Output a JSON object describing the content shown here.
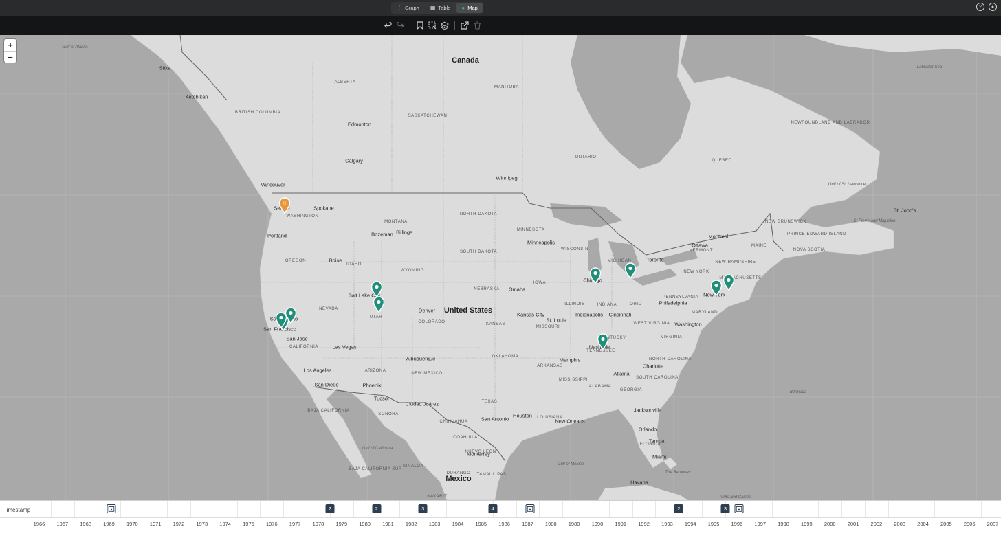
{
  "view_tabs": [
    {
      "label": "Graph",
      "icon": "graph-icon"
    },
    {
      "label": "Table",
      "icon": "table-icon"
    },
    {
      "label": "Map",
      "icon": "map-icon",
      "active": true
    }
  ],
  "map": {
    "labels": {
      "countries": [
        "Canada",
        "United States",
        "Mexico"
      ],
      "provinces": [
        "ALBERTA",
        "MANITOBA",
        "BRITISH COLUMBIA",
        "SASKATCHEWAN",
        "ONTARIO",
        "QUEBEC",
        "NEWFOUNDLAND AND LABRADOR",
        "NEW BRUNSWICK",
        "PRINCE EDWARD ISLAND",
        "NOVA SCOTIA"
      ],
      "states": [
        "WASHINGTON",
        "MONTANA",
        "NORTH DAKOTA",
        "MINNESOTA",
        "OREGON",
        "IDAHO",
        "WYOMING",
        "SOUTH DAKOTA",
        "WISCONSIN",
        "MICHIGAN",
        "NEVADA",
        "UTAH",
        "NEBRASKA",
        "IOWA",
        "ILLINOIS",
        "INDIANA",
        "OHIO",
        "PENNSYLVANIA",
        "CALIFORNIA",
        "COLORADO",
        "KANSAS",
        "MISSOURI",
        "KENTUCKY",
        "WEST VIRGINIA",
        "VIRGINIA",
        "ARIZONA",
        "NEW MEXICO",
        "OKLAHOMA",
        "ARKANSAS",
        "TENNESSEE",
        "NORTH CAROLINA",
        "SOUTH CAROLINA",
        "MISSISSIPPI",
        "ALABAMA",
        "GEORGIA",
        "TEXAS",
        "LOUISIANA",
        "FLORIDA",
        "NEW YORK",
        "VERMONT",
        "NEW HAMPSHIRE",
        "MAINE",
        "MASSACHUSETTS",
        "MARYLAND",
        "BAJA CALIFORNIA",
        "BAJA CALIFORNIA SUR",
        "SONORA",
        "CHIHUAHUA",
        "COAHUILA",
        "NUEVO LEON",
        "SINALOA",
        "DURANGO",
        "TAMAULIPAS",
        "NAYARIT"
      ],
      "cities": [
        "Edmonton",
        "Calgary",
        "Winnipeg",
        "Vancouver",
        "Seattle",
        "Spokane",
        "Portland",
        "Boise",
        "Bozeman",
        "Billings",
        "Minneapolis",
        "Toronto",
        "Montreal",
        "Ottawa",
        "Chicago",
        "Salt Lake City",
        "Denver",
        "Omaha",
        "Kansas City",
        "St. Louis",
        "Indianapolis",
        "Cincinnati",
        "Philadelphia",
        "New York",
        "Washington",
        "San Francisco",
        "Sacramento",
        "San Jose",
        "Las Vegas",
        "Los Angeles",
        "San Diego",
        "Phoenix",
        "Tucson",
        "Albuquerque",
        "Nashville",
        "Memphis",
        "Atlanta",
        "Charlotte",
        "Ciudad Juárez",
        "San Antonio",
        "Houston",
        "New Orleans",
        "Jacksonville",
        "Orlando",
        "Tampa",
        "Miami",
        "Havana",
        "Monterrey",
        "Ketchikan",
        "Sitka",
        "St. John's"
      ],
      "water_and_other": [
        "Gulf of Alaska",
        "Labrador Sea",
        "Gulf of St. Lawrence",
        "Gulf of California",
        "Gulf of Mexico",
        "Bermuda",
        "The Bahamas",
        "Turks and Caicos",
        "St Pierre and Miquelon"
      ]
    },
    "pins": [
      {
        "place": "Seattle",
        "color": "#e8963a",
        "glyph": "!!"
      },
      {
        "place": "Sacramento",
        "color": "#1f8f7a"
      },
      {
        "place": "San Francisco",
        "color": "#1f8f7a"
      },
      {
        "place": "San Francisco",
        "color": "#1f8f7a"
      },
      {
        "place": "Salt Lake City",
        "color": "#1f8f7a"
      },
      {
        "place": "Utah",
        "color": "#1f8f7a"
      },
      {
        "place": "Chicago",
        "color": "#1f8f7a"
      },
      {
        "place": "Michigan",
        "color": "#1f8f7a"
      },
      {
        "place": "Nashville",
        "color": "#1f8f7a"
      },
      {
        "place": "New York",
        "color": "#1f8f7a"
      },
      {
        "place": "Massachusetts",
        "color": "#1f8f7a"
      }
    ]
  },
  "timeline": {
    "row_label": "Timestamp",
    "years": [
      "1966",
      "1967",
      "1968",
      "1969",
      "1970",
      "1971",
      "1972",
      "1973",
      "1974",
      "1975",
      "1976",
      "1977",
      "1978",
      "1979",
      "1980",
      "1981",
      "1982",
      "1983",
      "1984",
      "1985",
      "1986",
      "1987",
      "1988",
      "1989",
      "1990",
      "1991",
      "1992",
      "1993",
      "1994",
      "1995",
      "1996",
      "1997",
      "1998",
      "1999",
      "2000",
      "2001",
      "2002",
      "2003",
      "2004",
      "2005",
      "2006",
      "2007"
    ],
    "events": [
      {
        "year": "1969",
        "type": "icon"
      },
      {
        "year": "1978",
        "count": "2"
      },
      {
        "year": "1980",
        "count": "2"
      },
      {
        "year": "1982",
        "count": "3"
      },
      {
        "year": "1985",
        "count": "4"
      },
      {
        "year": "1987",
        "type": "icon"
      },
      {
        "year": "1993",
        "count": "2"
      },
      {
        "year": "1995",
        "count": "3"
      },
      {
        "year": "1996",
        "type": "icon"
      }
    ]
  },
  "colors": {
    "pin_teal": "#1f8f7a",
    "pin_orange": "#e8963a",
    "badge": "#2c3e50"
  }
}
